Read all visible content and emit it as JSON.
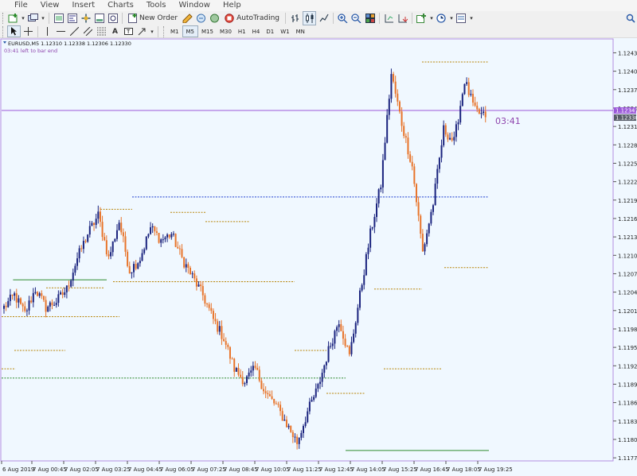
{
  "menu": [
    "File",
    "View",
    "Insert",
    "Charts",
    "Tools",
    "Window",
    "Help"
  ],
  "toolbar": {
    "new_order_label": "New Order",
    "autotrading_label": "AutoTrading",
    "timeframes": [
      "M1",
      "M5",
      "M15",
      "M30",
      "H1",
      "H4",
      "D1",
      "W1",
      "MN"
    ],
    "active_timeframe": "M5"
  },
  "colors": {
    "chart_background": "#f0f8ff",
    "bull_candle": "#1a237e",
    "bear_candle": "#e8742a",
    "bid_line": "#9b59d9",
    "text_purple": "#8e44ad",
    "support_line": "#2e8b2e",
    "level_dotted": "#b8860b",
    "blue_level": "#1f3fcf"
  },
  "chart_data": {
    "type": "candlestick",
    "symbol_info": "EURUSD,M5  1.12310 1.12338 1.12306 1.12330",
    "countdown_text": "03:41 left to bar end",
    "countdown_short": "03:41",
    "bid_price": "1.12341",
    "ask_price": "1.12330",
    "ylim": [
      1.1177,
      1.12455
    ],
    "y_ticks": [
      "1.12435",
      "1.12405",
      "1.12375",
      "1.12345",
      "1.12315",
      "1.12285",
      "1.12255",
      "1.12225",
      "1.12195",
      "1.12165",
      "1.12135",
      "1.12105",
      "1.12075",
      "1.12045",
      "1.12015",
      "1.11985",
      "1.11955",
      "1.11925",
      "1.11895",
      "1.11865",
      "1.11835",
      "1.11805",
      "1.11775"
    ],
    "x_labels": [
      "6 Aug 2019",
      "7 Aug 00:45",
      "7 Aug 02:05",
      "7 Aug 03:25",
      "7 Aug 04:45",
      "7 Aug 06:05",
      "7 Aug 07:25",
      "7 Aug 08:45",
      "7 Aug 10:05",
      "7 Aug 11:25",
      "7 Aug 12:45",
      "7 Aug 14:05",
      "7 Aug 15:25",
      "7 Aug 16:45",
      "7 Aug 18:05",
      "7 Aug 19:25"
    ],
    "key_closes": [
      [
        0,
        1.1202
      ],
      [
        5,
        1.1204
      ],
      [
        10,
        1.1201
      ],
      [
        15,
        1.1205
      ],
      [
        20,
        1.1202
      ],
      [
        25,
        1.1203
      ],
      [
        30,
        1.1205
      ],
      [
        35,
        1.121
      ],
      [
        40,
        1.1214
      ],
      [
        45,
        1.1217
      ],
      [
        50,
        1.121
      ],
      [
        55,
        1.1216
      ],
      [
        60,
        1.1208
      ],
      [
        65,
        1.121
      ],
      [
        70,
        1.1215
      ],
      [
        75,
        1.1213
      ],
      [
        80,
        1.1214
      ],
      [
        85,
        1.121
      ],
      [
        90,
        1.1207
      ],
      [
        95,
        1.1204
      ],
      [
        100,
        1.12
      ],
      [
        105,
        1.1197
      ],
      [
        110,
        1.1192
      ],
      [
        115,
        1.119
      ],
      [
        120,
        1.1192
      ],
      [
        125,
        1.1188
      ],
      [
        130,
        1.1186
      ],
      [
        135,
        1.1183
      ],
      [
        140,
        1.118
      ],
      [
        145,
        1.1185
      ],
      [
        150,
        1.1189
      ],
      [
        155,
        1.1195
      ],
      [
        160,
        1.12
      ],
      [
        165,
        1.1194
      ],
      [
        170,
        1.1204
      ],
      [
        175,
        1.1214
      ],
      [
        180,
        1.1222
      ],
      [
        185,
        1.124
      ],
      [
        190,
        1.1232
      ],
      [
        195,
        1.1225
      ],
      [
        200,
        1.1211
      ],
      [
        205,
        1.1219
      ],
      [
        210,
        1.1231
      ],
      [
        215,
        1.1229
      ],
      [
        220,
        1.1239
      ],
      [
        225,
        1.1234
      ],
      [
        230,
        1.1233
      ]
    ],
    "bid_level": 1.12341,
    "levels": [
      {
        "price": 1.1242,
        "from": 0.66,
        "to": 0.765,
        "style": "dotted",
        "color": "level_dotted"
      },
      {
        "price": 1.122,
        "from": 0.205,
        "to": 0.765,
        "style": "dotted",
        "color": "blue_level"
      },
      {
        "price": 1.1218,
        "from": 0.155,
        "to": 0.205,
        "style": "dotted",
        "color": "level_dotted"
      },
      {
        "price": 1.12175,
        "from": 0.265,
        "to": 0.32,
        "style": "dotted",
        "color": "level_dotted"
      },
      {
        "price": 1.1216,
        "from": 0.32,
        "to": 0.39,
        "style": "dotted",
        "color": "level_dotted"
      },
      {
        "price": 1.12085,
        "from": 0.695,
        "to": 0.765,
        "style": "dotted",
        "color": "level_dotted"
      },
      {
        "price": 1.12065,
        "from": 0.018,
        "to": 0.165,
        "style": "solid",
        "color": "support_line"
      },
      {
        "price": 1.12062,
        "from": 0.175,
        "to": 0.46,
        "style": "dotted",
        "color": "level_dotted"
      },
      {
        "price": 1.12052,
        "from": 0.07,
        "to": 0.16,
        "style": "dotted",
        "color": "level_dotted"
      },
      {
        "price": 1.1205,
        "from": 0.585,
        "to": 0.66,
        "style": "dotted",
        "color": "level_dotted"
      },
      {
        "price": 1.12005,
        "from": 0.0,
        "to": 0.185,
        "style": "dotted",
        "color": "level_dotted"
      },
      {
        "price": 1.1195,
        "from": 0.02,
        "to": 0.1,
        "style": "dotted",
        "color": "level_dotted"
      },
      {
        "price": 1.1195,
        "from": 0.46,
        "to": 0.51,
        "style": "dotted",
        "color": "level_dotted"
      },
      {
        "price": 1.1192,
        "from": 0.6,
        "to": 0.69,
        "style": "dotted",
        "color": "level_dotted"
      },
      {
        "price": 1.1192,
        "from": 0.0,
        "to": 0.022,
        "style": "dotted",
        "color": "level_dotted"
      },
      {
        "price": 1.11905,
        "from": 0.0,
        "to": 0.54,
        "style": "dotted",
        "color": "support_line"
      },
      {
        "price": 1.1188,
        "from": 0.51,
        "to": 0.57,
        "style": "dotted",
        "color": "level_dotted"
      },
      {
        "price": 1.11787,
        "from": 0.54,
        "to": 0.765,
        "style": "solid",
        "color": "support_line"
      }
    ]
  }
}
